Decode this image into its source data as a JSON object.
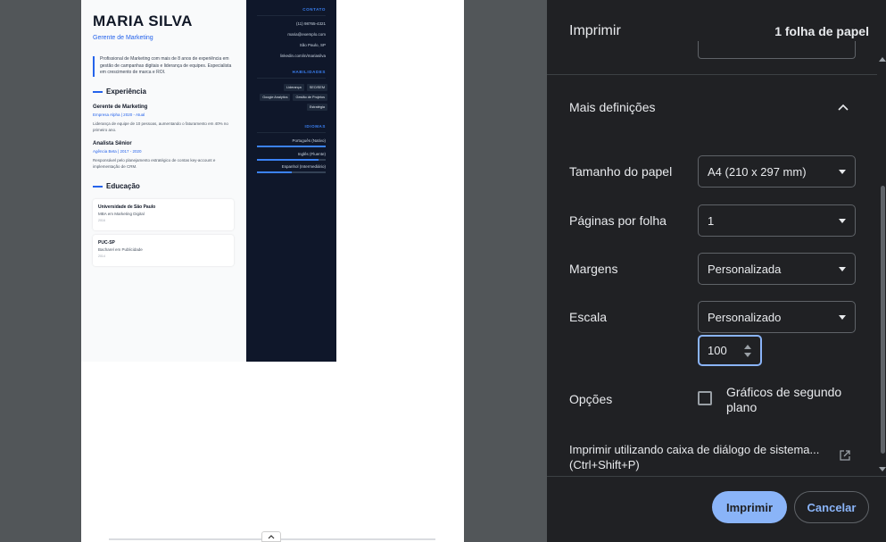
{
  "preview": {
    "resume": {
      "name": "MARIA SILVA",
      "role": "Gerente de Marketing",
      "summary": "Profissional de Marketing com mais de 8 anos de experiência em gestão de campanhas digitais e liderança de equipes. Especialista em crescimento de marca e ROI.",
      "experience_heading": "Experiência",
      "jobs": [
        {
          "title": "Gerente de Marketing",
          "meta": "Empresa Alpha | 2020 - Atual",
          "desc": "Liderança de equipe de 10 pessoas, aumentando o faturamento em 40% no primeiro ano."
        },
        {
          "title": "Analista Sênior",
          "meta": "Agência Beta | 2017 - 2020",
          "desc": "Responsável pelo planejamento estratégico de contas key-account e implementação de CRM."
        }
      ],
      "education_heading": "Educação",
      "education": [
        {
          "school": "Universidade de São Paulo",
          "degree": "MBA em Marketing Digital",
          "year": "2016"
        },
        {
          "school": "PUC-SP",
          "degree": "Bacharel em Publicidade",
          "year": "2014"
        }
      ],
      "contact_heading": "CONTATO",
      "contact": [
        "(11) 98765-4321",
        "maria@exemplo.com",
        "São Paulo, SP",
        "linkedin.com/in/mariasilva"
      ],
      "skills_heading": "HABILIDADES",
      "skills": [
        "Liderança",
        "SEO/SEM",
        "Google Analytics",
        "Gestão de Projetos",
        "Estratégia"
      ],
      "languages_heading": "IDIOMAS",
      "languages": [
        {
          "name": "Português (Nativo)",
          "level": 1.0
        },
        {
          "name": "Inglês (Fluente)",
          "level": 0.9
        },
        {
          "name": "Espanhol (Intermediário)",
          "level": 0.5
        }
      ]
    },
    "scroll_handle_icon": "chevron-up-icon"
  },
  "panel": {
    "title": "Imprimir",
    "sheets": "1 folha de papel",
    "more_settings_label": "Mais definições",
    "paper_size": {
      "label": "Tamanho do papel",
      "value": "A4 (210 x 297 mm)"
    },
    "pages_per_sheet": {
      "label": "Páginas por folha",
      "value": "1"
    },
    "margins": {
      "label": "Margens",
      "value": "Personalizada"
    },
    "scale": {
      "label": "Escala",
      "value": "Personalizado",
      "custom_value": "100"
    },
    "options": {
      "label": "Opções",
      "checkbox_label": "Gráficos de segundo plano",
      "checked": false
    },
    "system_dialog": "Imprimir utilizando caixa de diálogo de sistema... (Ctrl+Shift+P)",
    "print_button": "Imprimir",
    "cancel_button": "Cancelar"
  },
  "colors": {
    "accent": "#8ab4f8",
    "panel_bg": "#202124",
    "preview_bg": "#525659",
    "resume_accent": "#2563eb",
    "resume_sidebar": "#0f172a"
  }
}
